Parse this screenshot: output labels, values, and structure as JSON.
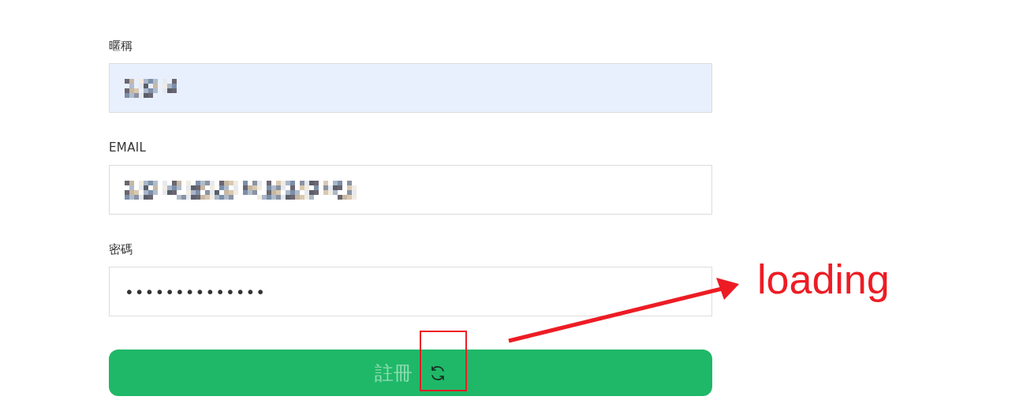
{
  "fields": [
    {
      "label": "暱稱",
      "kind": "pixelated",
      "autofilled": true
    },
    {
      "label": "EMAIL",
      "kind": "pixelated",
      "autofilled": false
    },
    {
      "label": "密碼",
      "kind": "password",
      "value": "••••••••••••••",
      "autofilled": false
    }
  ],
  "submit_button": {
    "label": "註冊",
    "loading": true
  },
  "annotation": {
    "text": "loading",
    "color": "#ed1c24"
  }
}
